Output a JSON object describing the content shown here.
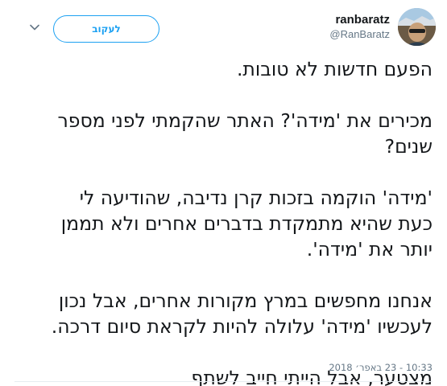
{
  "author": {
    "display_name": "ranbaratz",
    "handle": "@RanBaratz"
  },
  "follow_button": {
    "label": "לעקוב"
  },
  "menu": {
    "icon": "chevron-down-icon"
  },
  "tweet": {
    "paragraphs": [
      {
        "lines": [
          "הפעם חדשות לא טובות."
        ]
      },
      {
        "lines": [
          "מכירים את 'מידה'? האתר שהקמתי לפני מספר",
          "שנים?"
        ]
      },
      {
        "lines": [
          "'מידה' הוקמה בזכות קרן נדיבה, שהודיעה לי",
          "כעת שהיא מתמקדת בדברים אחרים ולא תממן",
          "יותר את 'מידה'."
        ]
      },
      {
        "lines": [
          "אנחנו מחפשים במרץ מקורות אחרים, אבל נכון",
          "לעכשיו 'מידה' עלולה להיות לקראת סיום דרכה."
        ]
      },
      {
        "lines": [
          "מצטער, אבל הייתי חייב לשתף"
        ]
      }
    ],
    "timestamp": "10:33 - 23 באפר׳ 2018"
  },
  "colors": {
    "accent": "#1da1f2",
    "text": "#14171a",
    "muted": "#657786"
  }
}
